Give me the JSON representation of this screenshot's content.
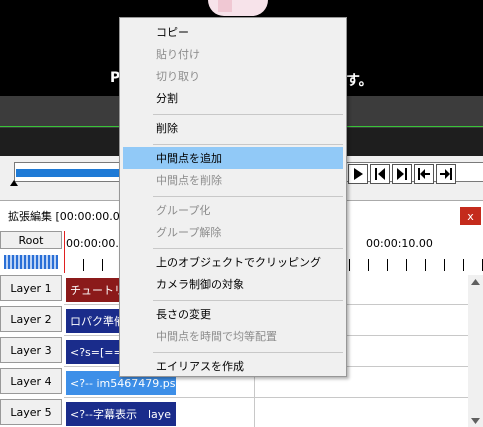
{
  "preview": {
    "subtitle_left": "P",
    "subtitle_right": "す。"
  },
  "edit_window": {
    "title": "拡張編集 [00:00:00.00",
    "close_label": "x",
    "root_label": "Root",
    "ruler": {
      "time_start": "00:00:00.00",
      "time_mid": "00:00:10.00"
    },
    "layers": [
      "Layer 1",
      "Layer 2",
      "Layer 3",
      "Layer 4",
      "Layer 5"
    ],
    "clips": {
      "layer1": "チュートリア",
      "layer2": "ロパク準備",
      "layer3": "<?s=[==[",
      "layer4": "<?-- im5467479.psd",
      "layer5": "<?--字幕表示　laye"
    }
  },
  "context_menu": {
    "items": [
      {
        "label": "コピー",
        "enabled": true
      },
      {
        "label": "貼り付け",
        "enabled": false
      },
      {
        "label": "切り取り",
        "enabled": false
      },
      {
        "label": "分割",
        "enabled": true
      },
      {
        "label": "削除",
        "enabled": true
      },
      {
        "label": "中間点を追加",
        "enabled": true,
        "selected": true
      },
      {
        "label": "中間点を削除",
        "enabled": false
      },
      {
        "label": "グループ化",
        "enabled": false
      },
      {
        "label": "グループ解除",
        "enabled": false
      },
      {
        "label": "上のオブジェクトでクリッピング",
        "enabled": true
      },
      {
        "label": "カメラ制御の対象",
        "enabled": true
      },
      {
        "label": "長さの変更",
        "enabled": true
      },
      {
        "label": "中間点を時間で均等配置",
        "enabled": false
      },
      {
        "label": "エイリアスを作成",
        "enabled": true
      }
    ]
  },
  "colors": {
    "accent_selected": "#91c9f7",
    "seek_fill": "#1e7ad6",
    "clip_red": "#8b1a1a",
    "clip_navy": "#1a2c8b",
    "clip_lightblue": "#3d8fe8",
    "close_red": "#c42b1c"
  }
}
